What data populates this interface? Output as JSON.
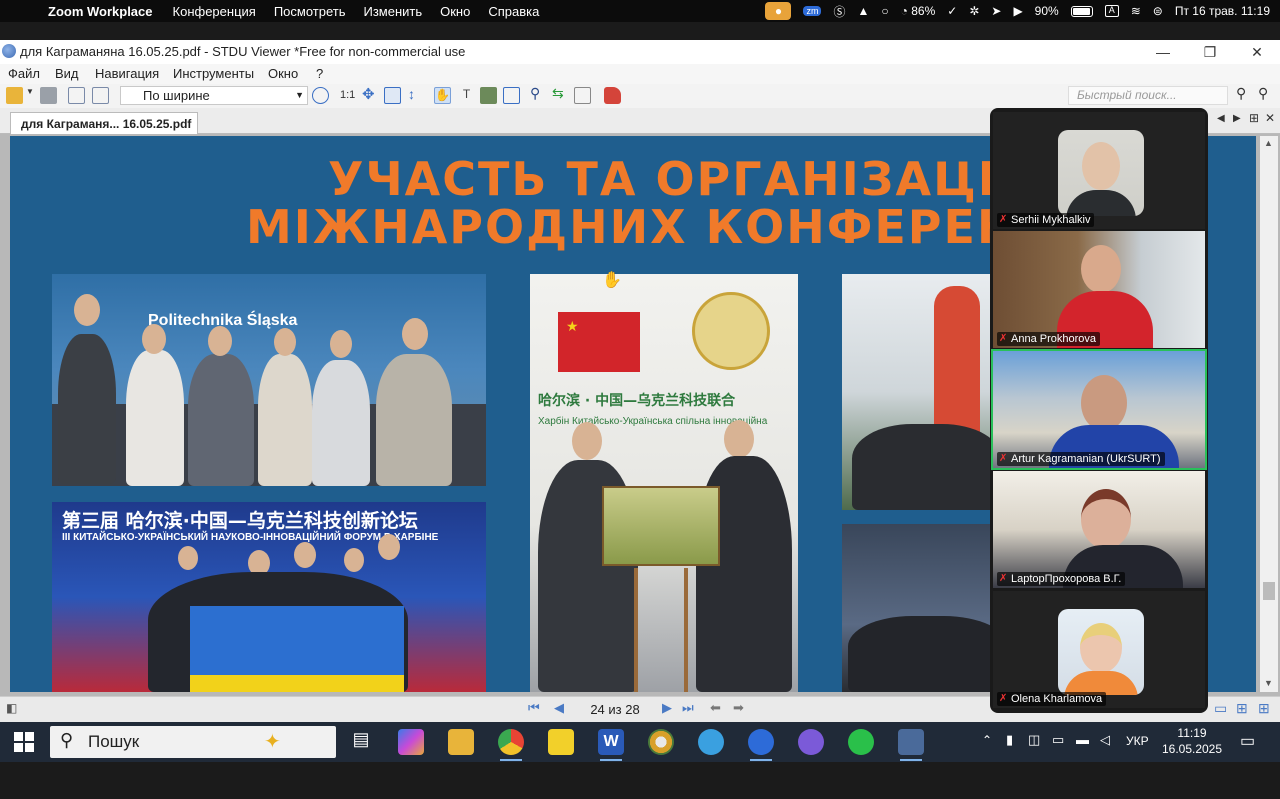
{
  "mac_menubar": {
    "app_name": "Zoom Workplace",
    "menus": [
      "Конференция",
      "Посмотреть",
      "Изменить",
      "Окно",
      "Справка"
    ],
    "status": {
      "cpu_percent": "86%",
      "battery_percent": "90%",
      "input_lang": "A",
      "datetime": "Пт 16 трав.  11:19"
    }
  },
  "window": {
    "title": "для Каграманяна   16.05.25.pdf - STDU Viewer *Free for non-commercial use"
  },
  "app_menu": [
    "Файл",
    "Вид",
    "Навигация",
    "Инструменты",
    "Окно",
    "?"
  ],
  "toolbar": {
    "zoom_mode": "По ширине",
    "scale_label": "1:1",
    "search_placeholder": "Быстрый поиск..."
  },
  "tab": {
    "label": "для Каграманя...  16.05.25.pdf"
  },
  "slide": {
    "title_line1": "УЧАСТЬ ТА ОРГАНІЗАЦІЯ",
    "title_line2": "МІЖНАРОДНИХ КОНФЕРЕНЦІЙ",
    "photo1_banner": "Politechnika Śląska",
    "photo3_banner_cn": "第三届 哈尔滨·中国—乌克兰科技创新论坛",
    "photo3_banner_ua": "III КИТАЙСЬКО-УКРАЇНСЬКИЙ НАУКОВО-ІННОВАЦІЙНИЙ ФОРУМ В ХАРБІНЕ",
    "photo2_banner_cn": "哈尔滨 · 中国—乌克兰科技联合",
    "photo2_banner_ua": "Харбін Китайсько-Українська спільна інноваційна"
  },
  "status_bar": {
    "page_indicator": "24 из 28"
  },
  "zoom_participants": [
    {
      "name": "Serhii Mykhalkiv",
      "muted": true,
      "video": false
    },
    {
      "name": "Anna Prokhorova",
      "muted": true,
      "video": true
    },
    {
      "name": "Artur Kagramanian (UkrSURT)",
      "muted": true,
      "video": true,
      "active_speaker": true
    },
    {
      "name": "LaptopПрохорова В.Г.",
      "muted": true,
      "video": true
    },
    {
      "name": "Olena Kharlamova",
      "muted": true,
      "video": false
    }
  ],
  "taskbar": {
    "search_label": "Пошук",
    "lang": "УКР",
    "time": "11:19",
    "date": "16.05.2025"
  },
  "colors": {
    "slide_bg": "#1f5e8e",
    "title_orange": "#f07a2a",
    "active_speaker": "#29c05a",
    "taskbar_bg": "#202a38"
  }
}
